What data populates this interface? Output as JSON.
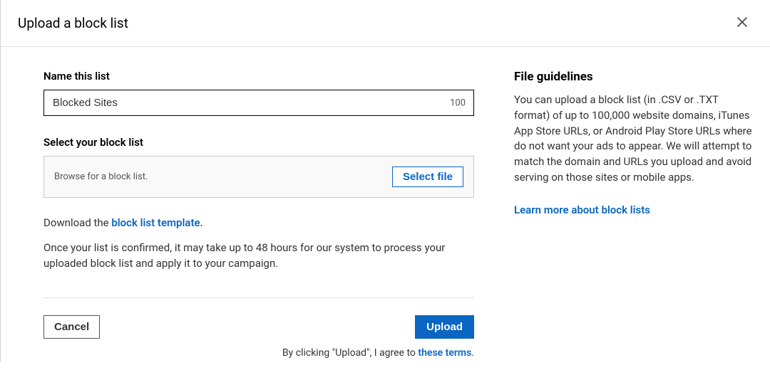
{
  "header": {
    "title": "Upload a block list"
  },
  "form": {
    "name_label": "Name this list",
    "name_value": "Blocked Sites",
    "char_remaining": "100",
    "select_label": "Select your block list",
    "browse_placeholder": "Browse for a block list.",
    "select_file_button": "Select file",
    "download_prefix": "Download the ",
    "download_link": "block list template.",
    "confirm_note": "Once your list is confirmed, it may take up to 48 hours for our system to process your uploaded block list and apply it to your campaign."
  },
  "actions": {
    "cancel": "Cancel",
    "upload": "Upload",
    "terms_prefix": "By clicking \"Upload\", I agree to ",
    "terms_link": "these terms",
    "terms_suffix": "."
  },
  "guidelines": {
    "title": "File guidelines",
    "body": "You can upload a block list (in .CSV or .TXT format) of up to 100,000 website domains, iTunes App Store URLs, or Android Play Store URLs where do not want your ads to appear. We will attempt to match the domain and URLs you upload and avoid serving on those sites or mobile apps.",
    "learn_more": "Learn more about block lists"
  }
}
